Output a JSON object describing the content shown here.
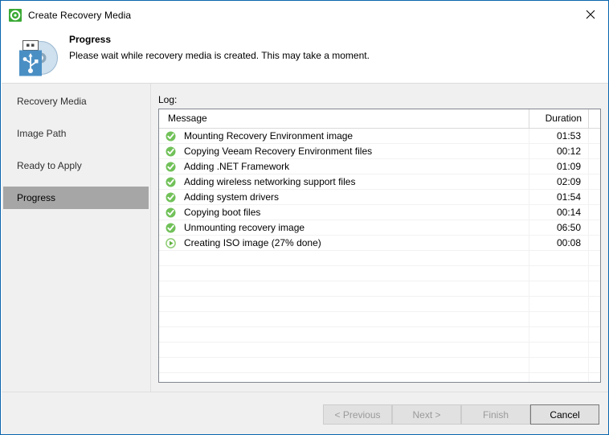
{
  "window": {
    "title": "Create Recovery Media",
    "title_icon": "veeam-ring-icon",
    "close_icon": "close-icon"
  },
  "header": {
    "icon": "usb-disc-media-icon",
    "title": "Progress",
    "subtitle": "Please wait while recovery media is created. This may take a moment."
  },
  "sidebar": {
    "items": [
      {
        "label": "Recovery Media",
        "selected": false
      },
      {
        "label": "Image Path",
        "selected": false
      },
      {
        "label": "Ready to Apply",
        "selected": false
      },
      {
        "label": "Progress",
        "selected": true
      }
    ]
  },
  "main": {
    "log_label": "Log:",
    "columns": [
      "Message",
      "Duration",
      ""
    ],
    "rows": [
      {
        "icon": "success-check-icon",
        "message": "Mounting Recovery Environment image",
        "duration": "01:53"
      },
      {
        "icon": "success-check-icon",
        "message": "Copying Veeam Recovery Environment files",
        "duration": "00:12"
      },
      {
        "icon": "success-check-icon",
        "message": "Adding .NET Framework",
        "duration": "01:09"
      },
      {
        "icon": "success-check-icon",
        "message": "Adding wireless networking support files",
        "duration": "02:09"
      },
      {
        "icon": "success-check-icon",
        "message": "Adding system drivers",
        "duration": "01:54"
      },
      {
        "icon": "success-check-icon",
        "message": "Copying boot files",
        "duration": "00:14"
      },
      {
        "icon": "success-check-icon",
        "message": "Unmounting recovery image",
        "duration": "06:50"
      },
      {
        "icon": "in-progress-play-icon",
        "message": "Creating ISO image (27% done)",
        "duration": "00:08"
      }
    ],
    "empty_row_count": 9
  },
  "footer": {
    "previous_label": "< Previous",
    "next_label": "Next >",
    "finish_label": "Finish",
    "cancel_label": "Cancel"
  },
  "colors": {
    "window_border": "#0a64ad",
    "success_green": "#71c159",
    "usb_blue": "#4a8fc4",
    "selection_gray": "#a6a6a6",
    "panel_gray": "#f0f0f0"
  }
}
